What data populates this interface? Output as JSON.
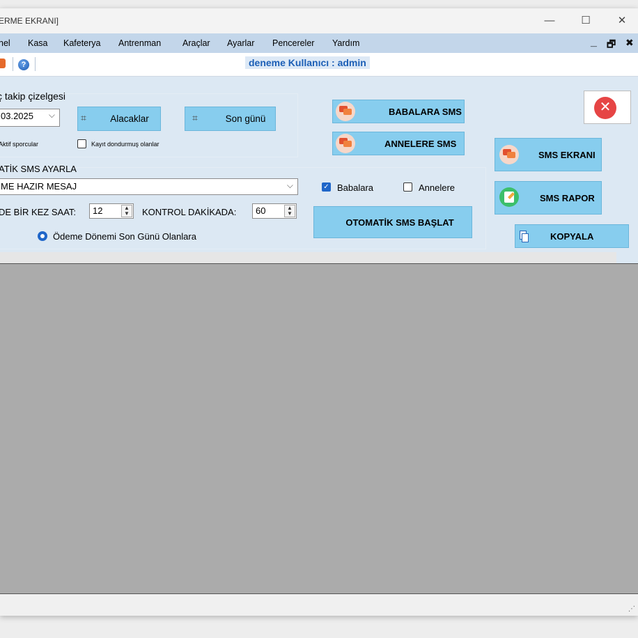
{
  "window": {
    "title": "ERME EKRANI]",
    "controls": {
      "minimize": "—",
      "maximize": "☐",
      "close": "✕"
    }
  },
  "menu": {
    "items": [
      "nel",
      "Kasa",
      "Kafeterya",
      "Antrenman",
      "Araçlar",
      "Ayarlar",
      "Pencereler",
      "Yardım"
    ],
    "mdi_controls": {
      "minimize": "_",
      "restore": "🗗",
      "close": "✖"
    }
  },
  "toolbar": {
    "help_icon": "?",
    "user_banner": "deneme Kullanıcı : admin"
  },
  "tracking": {
    "group_title": "ç takip çizelgesi",
    "date_value": "03.2025",
    "alacaklar_label": "Alacaklar",
    "son_gunu_label": "Son günü",
    "active_athletes_label": "Aktif sporcular",
    "frozen_label": "Kayıt dondurmuş olanlar",
    "frozen_checked": false
  },
  "sms_buttons": {
    "babalara": "BABALARA SMS",
    "annelere": "ANNELERE SMS",
    "sms_ekrani": "SMS EKRANI",
    "sms_rapor": "SMS RAPOR",
    "kopyala": "KOPYALA",
    "close_icon": "✕"
  },
  "auto_sms": {
    "section_title": "ATİK SMS AYARLA",
    "message_value": "ME HAZIR MESAJ",
    "babalara_label": "Babalara",
    "babalara_checked": true,
    "annelere_label": "Annelere",
    "annelere_checked": false,
    "hour_label": "DE BİR KEZ SAAT:",
    "hour_value": "12",
    "minute_label": "KONTROL DAKİKADA:",
    "minute_value": "60",
    "start_button": "OTOMATİK SMS BAŞLAT",
    "radio_label": "Ödeme Dönemi Son Günü Olanlara",
    "radio_selected": true
  },
  "statusbar": {
    "grip": "⋰"
  },
  "colors": {
    "menubar": "#c3d6ea",
    "panel": "#dce8f3",
    "button": "#87cdee",
    "banner_text": "#1c5fb6",
    "grid_background": "#ababab",
    "close_red": "#e64545"
  }
}
